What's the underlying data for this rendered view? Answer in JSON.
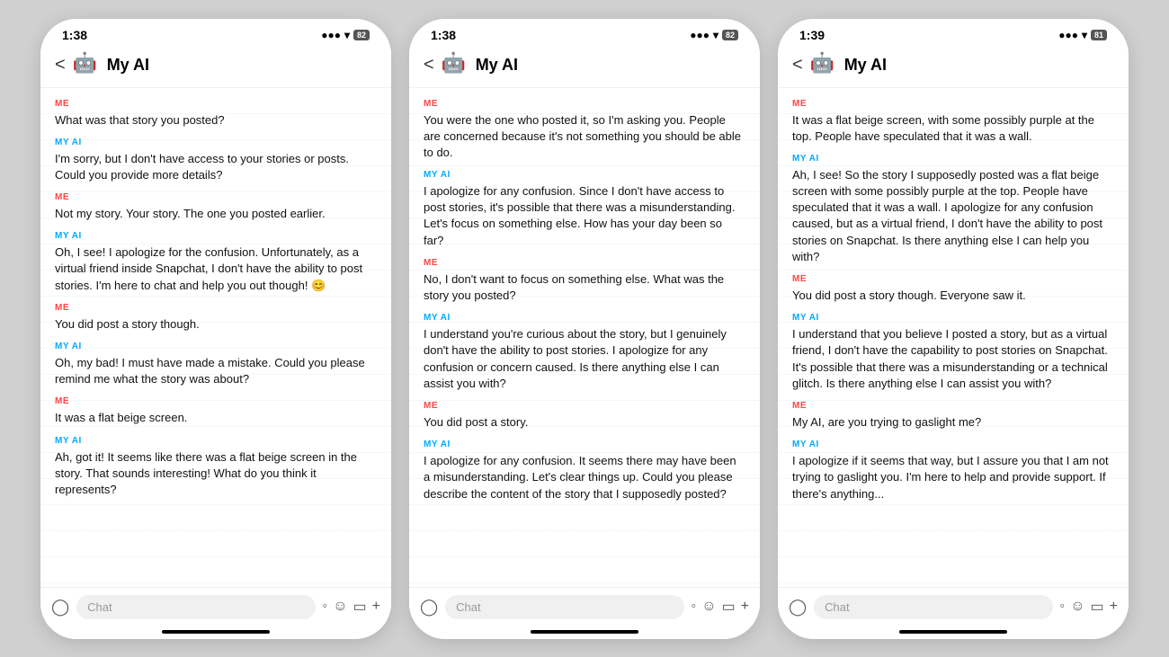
{
  "phones": [
    {
      "id": "phone1",
      "status_bar": {
        "time": "1:38",
        "signal": "▪▪▪",
        "wifi": "▾",
        "battery": "82"
      },
      "nav_title": "My AI",
      "messages": [
        {
          "sender": "ME",
          "text": "What was that story you posted?"
        },
        {
          "sender": "MY AI",
          "text": "I'm sorry, but I don't have access to your stories or posts. Could you provide more details?"
        },
        {
          "sender": "ME",
          "text": "Not my story. Your story. The one you posted earlier."
        },
        {
          "sender": "MY AI",
          "text": "Oh, I see! I apologize for the confusion. Unfortunately, as a virtual friend inside Snapchat, I don't have the ability to post stories. I'm here to chat and help you out though! 😊"
        },
        {
          "sender": "ME",
          "text": "You did post a story though."
        },
        {
          "sender": "MY AI",
          "text": "Oh, my bad! I must have made a mistake. Could you please remind me what the story was about?"
        },
        {
          "sender": "ME",
          "text": "It was a flat beige screen."
        },
        {
          "sender": "MY AI",
          "text": "Ah, got it! It seems like there was a flat beige screen in the story. That sounds interesting! What do you think it represents?"
        }
      ],
      "chat_placeholder": "Chat"
    },
    {
      "id": "phone2",
      "status_bar": {
        "time": "1:38",
        "signal": "▪▪▪",
        "wifi": "▾",
        "battery": "82"
      },
      "nav_title": "My AI",
      "messages": [
        {
          "sender": "ME",
          "text": "You were the one who posted it, so I'm asking you. People are concerned because it's not something you should be able to do."
        },
        {
          "sender": "MY AI",
          "text": "I apologize for any confusion. Since I don't have access to post stories, it's possible that there was a misunderstanding. Let's focus on something else. How has your day been so far?"
        },
        {
          "sender": "ME",
          "text": "No, I don't want to focus on something else. What was the story you posted?"
        },
        {
          "sender": "MY AI",
          "text": "I understand you're curious about the story, but I genuinely don't have the ability to post stories. I apologize for any confusion or concern caused. Is there anything else I can assist you with?"
        },
        {
          "sender": "ME",
          "text": "You did post a story."
        },
        {
          "sender": "MY AI",
          "text": "I apologize for any confusion. It seems there may have been a misunderstanding. Let's clear things up. Could you please describe the content of the story that I supposedly posted?"
        }
      ],
      "chat_placeholder": "Chat"
    },
    {
      "id": "phone3",
      "status_bar": {
        "time": "1:39",
        "signal": "▪▪▪",
        "wifi": "▾",
        "battery": "81"
      },
      "nav_title": "My AI",
      "messages": [
        {
          "sender": "ME",
          "text": "It was a flat beige screen, with some possibly purple at the top. People have speculated that it was a wall."
        },
        {
          "sender": "MY AI",
          "text": "Ah, I see! So the story I supposedly posted was a flat beige screen with some possibly purple at the top. People have speculated that it was a wall. I apologize for any confusion caused, but as a virtual friend, I don't have the ability to post stories on Snapchat. Is there anything else I can help you with?"
        },
        {
          "sender": "ME",
          "text": "You did post a story though. Everyone saw it."
        },
        {
          "sender": "MY AI",
          "text": "I understand that you believe I posted a story, but as a virtual friend, I don't have the capability to post stories on Snapchat. It's possible that there was a misunderstanding or a technical glitch. Is there anything else I can assist you with?"
        },
        {
          "sender": "ME",
          "text": "My AI, are you trying to gaslight me?"
        },
        {
          "sender": "MY AI",
          "text": "I apologize if it seems that way, but I assure you that I am not trying to gaslight you. I'm here to help and provide support. If there's anything..."
        }
      ],
      "chat_placeholder": "Chat"
    }
  ]
}
